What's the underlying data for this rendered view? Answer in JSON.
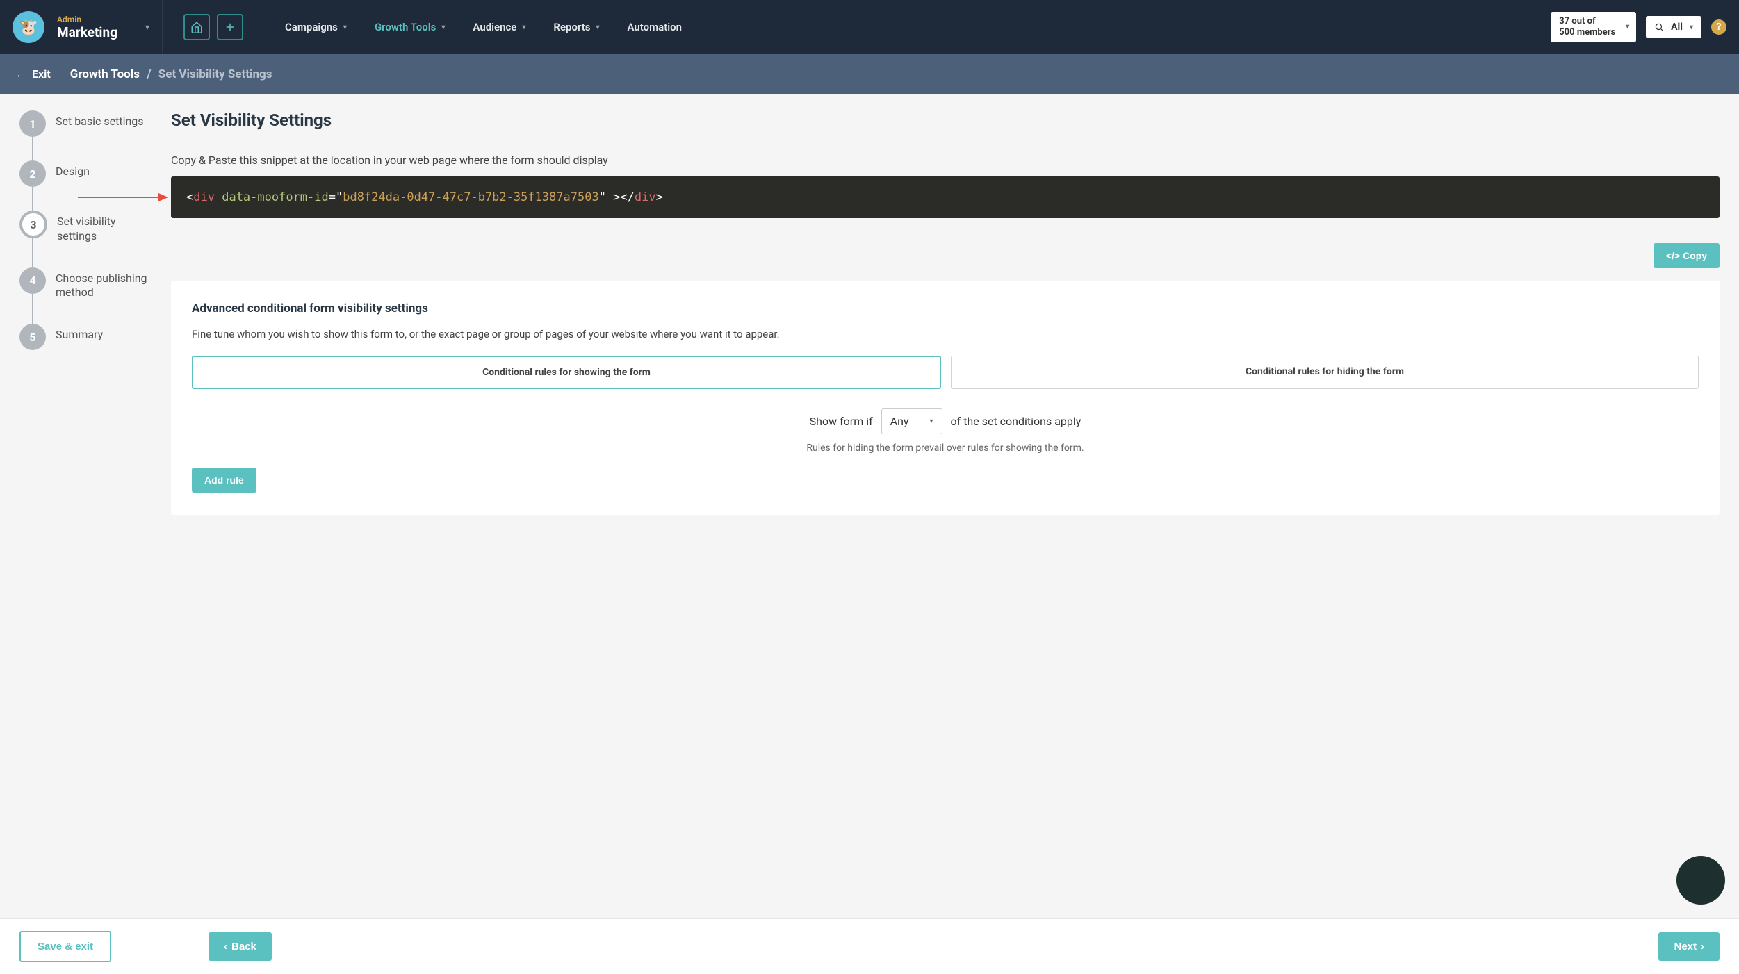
{
  "header": {
    "role": "Admin",
    "workspace": "Marketing",
    "nav": {
      "campaigns": "Campaigns",
      "growth_tools": "Growth Tools",
      "audience": "Audience",
      "reports": "Reports",
      "automation": "Automation"
    },
    "members_line1": "37 out of",
    "members_line2": "500 members",
    "search_label": "All"
  },
  "subheader": {
    "exit": "Exit",
    "crumb1": "Growth Tools",
    "crumb2": "Set Visibility Settings"
  },
  "stepper": {
    "s1": {
      "num": "1",
      "label": "Set basic settings"
    },
    "s2": {
      "num": "2",
      "label": "Design"
    },
    "s3": {
      "num": "3",
      "label": "Set visibility settings"
    },
    "s4": {
      "num": "4",
      "label": "Choose publishing method"
    },
    "s5": {
      "num": "5",
      "label": "Summary"
    }
  },
  "main": {
    "title": "Set Visibility Settings",
    "snippet_instruction": "Copy & Paste this snippet at the location in your web page where the form should display",
    "code": {
      "tag": "div",
      "attr": "data-mooform-id",
      "value": "bd8f24da-0d47-47c7-b7b2-35f1387a7503"
    },
    "copy_btn": "</>  Copy",
    "advanced_heading": "Advanced conditional form visibility settings",
    "advanced_desc": "Fine tune whom you wish to show this form to, or the exact page or group of pages of your website where you want it to appear.",
    "tab_show": "Conditional rules for showing the form",
    "tab_hide": "Conditional rules for hiding the form",
    "cond_prefix": "Show form if",
    "cond_select": "Any",
    "cond_suffix": "of the set conditions apply",
    "cond_hint": "Rules for hiding the form prevail over rules for showing the form.",
    "add_rule": "Add rule"
  },
  "footer": {
    "save_exit": "Save & exit",
    "back": "Back",
    "next": "Next"
  }
}
